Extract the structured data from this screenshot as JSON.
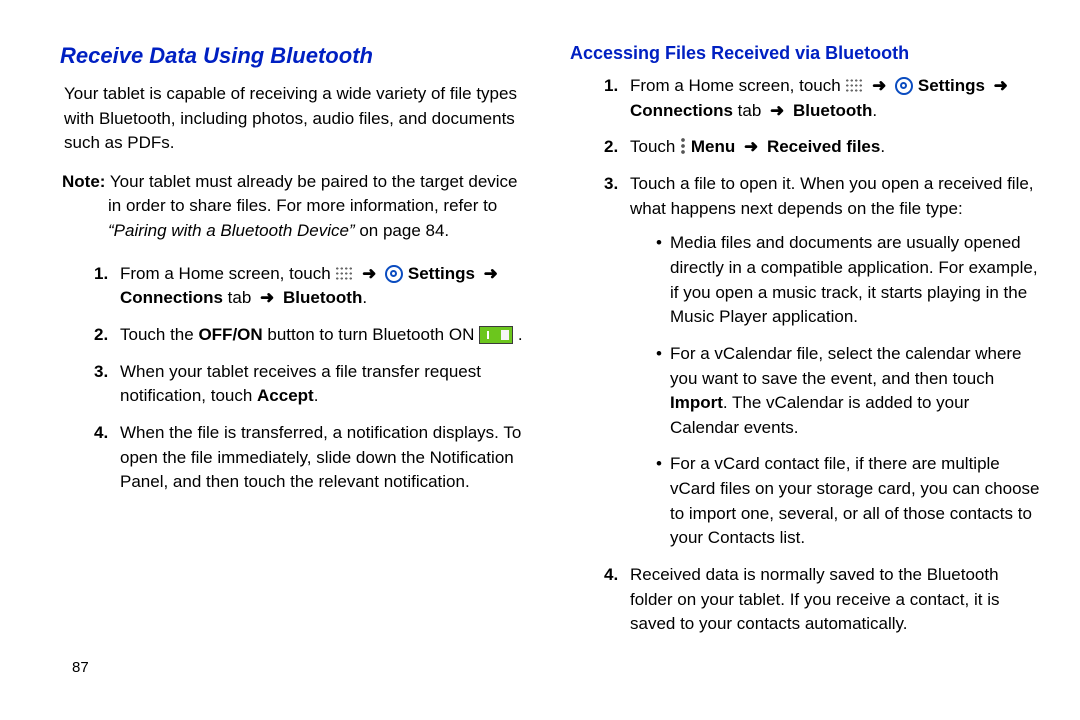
{
  "left": {
    "heading": "Receive Data Using Bluetooth",
    "intro": "Your tablet is capable of receiving a wide variety of file types with Bluetooth, including photos, audio files, and documents such as PDFs.",
    "note_label": "Note:",
    "note_line1": "Your tablet must already be paired to the target device",
    "note_line2": "in order to share files. For more information, refer to",
    "note_ref": "“Pairing with a Bluetooth Device”",
    "note_ref_suffix": " on page 84.",
    "step1_prefix": "From a Home screen, touch ",
    "settings_label": "Settings",
    "connections_label": "Connections",
    "tab_word": " tab ",
    "bluetooth_label": "Bluetooth",
    "step2_a": "Touch the ",
    "step2_b": "OFF/ON",
    "step2_c": " button to turn Bluetooth ON ",
    "step3_a": "When your tablet receives a file transfer request notification, touch ",
    "step3_b": "Accept",
    "step4": "When the file is transferred, a notification displays. To open the file immediately, slide down the Notification Panel, and then touch the relevant notification."
  },
  "right": {
    "heading": "Accessing Files Received via Bluetooth",
    "step1_prefix": "From a Home screen, touch ",
    "step2_a": "Touch ",
    "menu_label": "Menu",
    "received_files_label": "Received files",
    "step3_intro": "Touch a file to open it. When you open a received file, what happens next depends on the file type:",
    "bullet1": "Media files and documents are usually opened directly in a compatible application. For example, if you open a music track, it starts playing in the Music Player application.",
    "bullet2_a": "For a vCalendar file, select the calendar where you want to save the event, and then touch ",
    "bullet2_b": "Import",
    "bullet2_c": ". The vCalendar is added to your Calendar events.",
    "bullet3": "For a vCard contact file, if there are multiple vCard files on your storage card, you can choose to import one, several, or all of those contacts to your Contacts list.",
    "step4": "Received data is normally saved to the Bluetooth folder on your tablet. If you receive a contact, it is saved to your contacts automatically."
  },
  "page_number": "87",
  "arrow": "➜"
}
